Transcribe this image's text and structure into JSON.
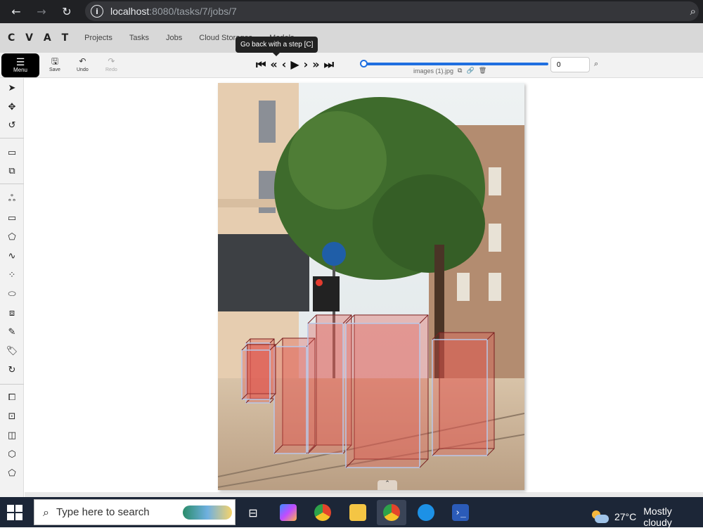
{
  "browser": {
    "url_host": "localhost",
    "url_rest": ":8080/tasks/7/jobs/7"
  },
  "header": {
    "logo": "CVAT",
    "nav": [
      "Projects",
      "Tasks",
      "Jobs",
      "Cloud Storages",
      "Models"
    ]
  },
  "tooltip": "Go back with a step [C]",
  "toolbar": {
    "menu_label": "Menu",
    "save_label": "Save",
    "undo_label": "Undo",
    "redo_label": "Redo",
    "filename": "images (1).jpg",
    "frame_value": "0",
    "frame_progress": 1.0
  },
  "sidebar_tools": [
    "cursor-icon",
    "move-icon",
    "rotate-icon",
    "fit-icon",
    "zoom-region-icon",
    "ai-tools-icon",
    "rectangle-icon",
    "polygon-icon",
    "polyline-icon",
    "points-icon",
    "ellipse-icon",
    "cuboid-icon",
    "mask-icon",
    "tag-icon",
    "opencv-icon",
    "merge-icon",
    "group-icon",
    "split-icon",
    "join-icon",
    "slice-icon"
  ],
  "annotations": {
    "label_color": "#e05a4f",
    "cuboid_edge_color": "#b9c7e8",
    "count": 6
  },
  "taskbar": {
    "search_placeholder": "Type here to search",
    "weather_temp": "27°C",
    "weather_text": "Mostly cloudy"
  }
}
